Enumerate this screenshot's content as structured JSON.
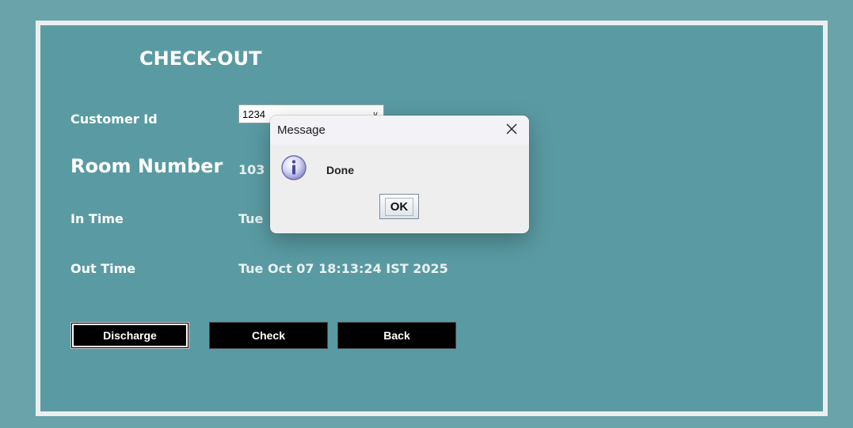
{
  "window": {
    "title": "CHECK-OUT"
  },
  "form": {
    "customer_id_label": "Customer Id",
    "customer_id_value": "1234",
    "room_number_label": "Room Number",
    "room_number_value": "103",
    "in_time_label": "In Time",
    "in_time_value": "Tue",
    "out_time_label": "Out Time",
    "out_time_value": "Tue Oct 07 18:13:24 IST 2025"
  },
  "buttons": {
    "discharge": "Discharge",
    "check": "Check",
    "back": "Back"
  },
  "dialog": {
    "title": "Message",
    "message": "Done",
    "ok_label": "OK",
    "icon": "info-icon",
    "close_icon": "close-icon"
  },
  "colors": {
    "background": "#6aa4aa",
    "panel": "#5a9ba3",
    "button": "#000000"
  }
}
